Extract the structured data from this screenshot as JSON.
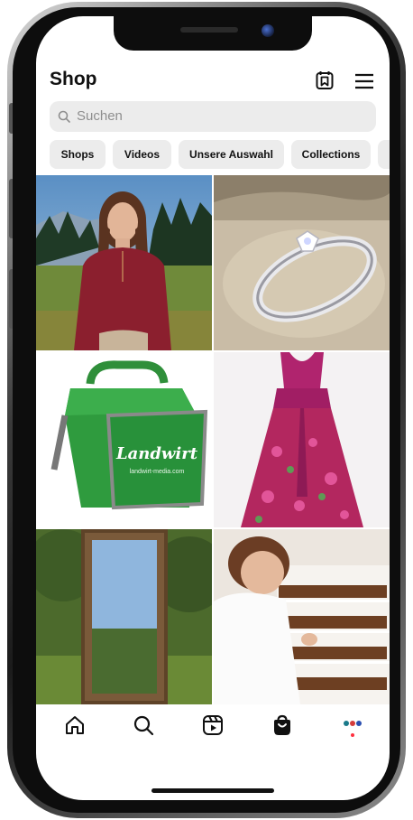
{
  "header": {
    "title": "Shop",
    "saved_icon": "shopping-collection-icon",
    "menu_icon": "hamburger-menu-icon"
  },
  "search": {
    "placeholder": "Suchen",
    "icon": "search-icon"
  },
  "chips": [
    {
      "label": "Shops"
    },
    {
      "label": "Videos"
    },
    {
      "label": "Unsere Auswahl"
    },
    {
      "label": "Collections"
    }
  ],
  "grid": {
    "tiles": [
      {
        "subject": "woman-red-sweater-mountain-photo"
      },
      {
        "subject": "diamond-ring-photo"
      },
      {
        "subject": "green-cooler-bag-photo",
        "brand_text": "Landwirt",
        "brand_url": "landwirt-media.com"
      },
      {
        "subject": "pink-floral-dirndl-photo"
      },
      {
        "subject": "wooden-mirror-garden-photo"
      },
      {
        "subject": "woman-pharmacy-shelf-photo"
      }
    ]
  },
  "tabbar": {
    "items": [
      {
        "icon": "home-icon"
      },
      {
        "icon": "search-icon"
      },
      {
        "icon": "reels-icon"
      },
      {
        "icon": "shop-bag-icon",
        "active": true
      },
      {
        "icon": "profile-avatar-icon"
      }
    ]
  },
  "colors": {
    "text": "#111111",
    "chip_bg": "#ececec",
    "search_bg": "#ececec",
    "placeholder": "#8e8e8e",
    "notification_dot": "#ff3040"
  }
}
